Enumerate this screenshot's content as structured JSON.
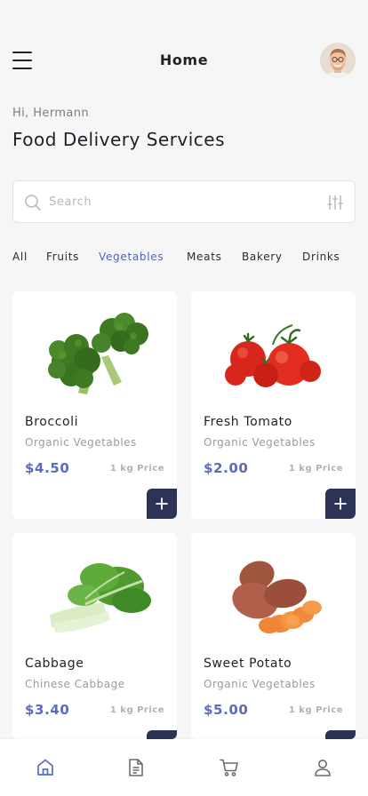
{
  "header": {
    "title": "Home",
    "menu_icon": "hamburger-menu-icon",
    "avatar_icon": "user-avatar"
  },
  "greeting": "Hi, Hermann",
  "headline": "Food Delivery Services",
  "search": {
    "placeholder": "Search",
    "value": "",
    "icon": "search-icon",
    "filter_icon": "sliders-icon"
  },
  "categories": {
    "items": [
      "All",
      "Fruits",
      "Vegetables",
      "Meats",
      "Bakery",
      "Drinks"
    ],
    "active": "Vegetables"
  },
  "products": [
    {
      "name": "Broccoli",
      "subtitle": "Organic Vegetables",
      "price": "$4.50",
      "unit": "1 kg Price",
      "image": "broccoli"
    },
    {
      "name": "Fresh Tomato",
      "subtitle": "Organic Vegetables",
      "price": "$2.00",
      "unit": "1 kg Price",
      "image": "tomato"
    },
    {
      "name": "Cabbage",
      "subtitle": "Chinese Cabbage",
      "price": "$3.40",
      "unit": "1 kg Price",
      "image": "bok-choy"
    },
    {
      "name": "Sweet Potato",
      "subtitle": "Organic Vegetables",
      "price": "$5.00",
      "unit": "1 kg Price",
      "image": "sweet-potato"
    }
  ],
  "bottom_nav": {
    "items": [
      "home-icon",
      "document-icon",
      "cart-icon",
      "profile-icon"
    ],
    "active": "home-icon"
  },
  "colors": {
    "accent": "#5c6bc0",
    "active_tab": "#5562b8",
    "add_button": "#2d3257",
    "background": "#f6f6f7"
  }
}
